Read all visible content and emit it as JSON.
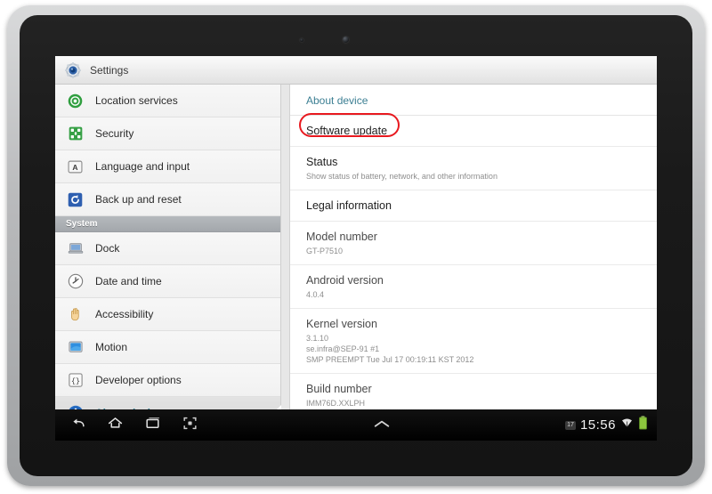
{
  "window": {
    "title": "Settings",
    "title_icon": "settings-gear-icon"
  },
  "sidebar": {
    "items": [
      {
        "label": "Location services",
        "icon": "location-target-icon",
        "type": "item",
        "selected": false
      },
      {
        "label": "Security",
        "icon": "security-grid-icon",
        "type": "item",
        "selected": false
      },
      {
        "label": "Language and input",
        "icon": "language-a-icon",
        "type": "item",
        "selected": false
      },
      {
        "label": "Back up and reset",
        "icon": "backup-reset-icon",
        "type": "item",
        "selected": false
      },
      {
        "label": "System",
        "icon": "",
        "type": "header",
        "selected": false
      },
      {
        "label": "Dock",
        "icon": "dock-laptop-icon",
        "type": "item",
        "selected": false
      },
      {
        "label": "Date and time",
        "icon": "clock-icon",
        "type": "item",
        "selected": false
      },
      {
        "label": "Accessibility",
        "icon": "hand-icon",
        "type": "item",
        "selected": false
      },
      {
        "label": "Motion",
        "icon": "motion-screen-icon",
        "type": "item",
        "selected": false
      },
      {
        "label": "Developer options",
        "icon": "braces-icon",
        "type": "item",
        "selected": false
      },
      {
        "label": "About device",
        "icon": "info-icon",
        "type": "item",
        "selected": true
      }
    ]
  },
  "content": {
    "title": "About device",
    "rows": [
      {
        "title": "Software update",
        "subtitle": "",
        "highlighted": true
      },
      {
        "title": "Status",
        "subtitle": "Show status of battery, network, and other information",
        "highlighted": false
      },
      {
        "title": "Legal information",
        "subtitle": "",
        "highlighted": false
      },
      {
        "title": "Model number",
        "subtitle": "GT-P7510",
        "highlighted": false
      },
      {
        "title": "Android version",
        "subtitle": "4.0.4",
        "highlighted": false
      },
      {
        "title": "Kernel version",
        "subtitle": "3.1.10\nse.infra@SEP-91 #1\nSMP PREEMPT Tue Jul 17 00:19:11 KST 2012",
        "highlighted": false
      },
      {
        "title": "Build number",
        "subtitle": "IMM76D.XXLPH",
        "highlighted": false
      }
    ]
  },
  "navbar": {
    "back_icon": "back-arrow-icon",
    "home_icon": "home-icon",
    "recents_icon": "recent-apps-icon",
    "screenshot_icon": "screenshot-capture-icon",
    "expand_icon": "chevron-up-icon",
    "status_badge": "17",
    "clock": "15:56",
    "wifi_icon": "wifi-icon",
    "battery_icon": "battery-full-icon"
  },
  "annotations": {
    "software_update_box": "red-highlight-box",
    "about_device_box": "red-highlight-box"
  },
  "colors": {
    "accent_teal": "#3c7f93",
    "annotation_red": "#e8191f",
    "battery_green": "#8cc63e"
  }
}
